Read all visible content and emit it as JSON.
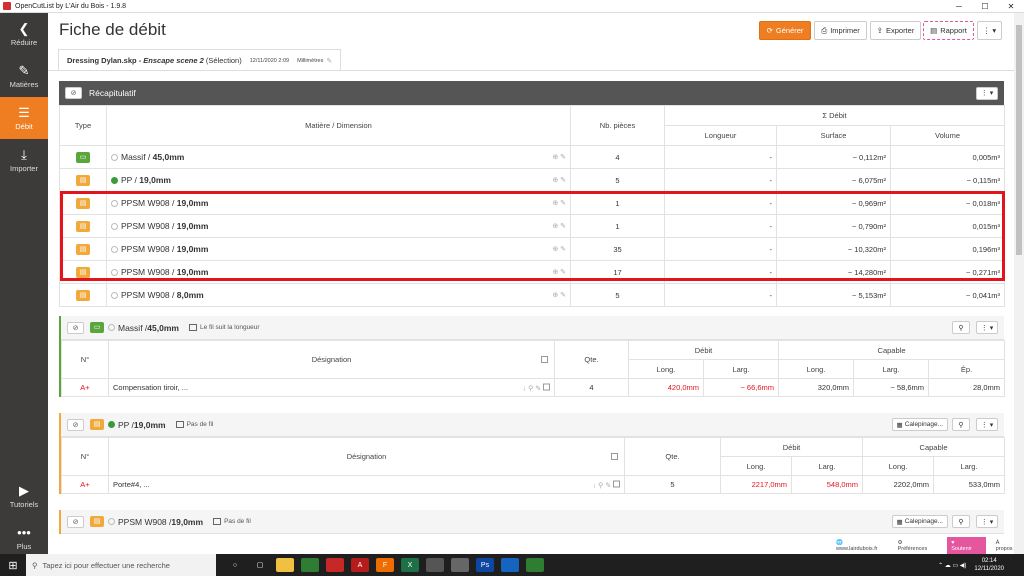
{
  "window": {
    "title": "OpenCutList by L'Air du Bois - 1.9.8"
  },
  "sidebar": {
    "items": [
      {
        "label": "Réduire",
        "icon": "chevron-left-icon"
      },
      {
        "label": "Matières",
        "icon": "materials-icon"
      },
      {
        "label": "Débit",
        "icon": "cutlist-icon"
      },
      {
        "label": "Importer",
        "icon": "import-icon"
      }
    ],
    "bottom": [
      {
        "label": "Tutoriels",
        "icon": "play-icon"
      },
      {
        "label": "Plus",
        "icon": "more-icon"
      }
    ]
  },
  "header": {
    "title": "Fiche de débit",
    "buttons": {
      "generate": "Générer",
      "print": "Imprimer",
      "export": "Exporter",
      "report": "Rapport"
    }
  },
  "doc_tab": {
    "filename": "Dressing Dylan.skp -",
    "scene": "Enscape scene 2",
    "selection": "(Sélection)",
    "date": "12/11/2020 2:09",
    "unit": "Millimètres"
  },
  "summary": {
    "title": "Récapitulatif",
    "headers": {
      "type": "Type",
      "material": "Matière / Dimension",
      "count": "Nb. pièces",
      "sum": "Σ Débit",
      "length": "Longueur",
      "surface": "Surface",
      "volume": "Volume"
    },
    "rows": [
      {
        "type": "green",
        "mat_name": "Massif / ",
        "mat_dim": "45,0mm",
        "count": "4",
        "length": "-",
        "surface": "~ 0,112m²",
        "volume": "0,005m³"
      },
      {
        "type": "orange",
        "mat_name": "PP / ",
        "mat_dim": "19,0mm",
        "count": "5",
        "length": "-",
        "surface": "~ 6,075m²",
        "volume": "~ 0,115m³"
      },
      {
        "type": "orange",
        "mat_name": "PPSM W908 / ",
        "mat_dim": "19,0mm",
        "count": "1",
        "length": "-",
        "surface": "~ 0,969m²",
        "volume": "~ 0,018m³"
      },
      {
        "type": "orange",
        "mat_name": "PPSM W908 / ",
        "mat_dim": "19,0mm",
        "count": "1",
        "length": "-",
        "surface": "~ 0,790m²",
        "volume": "0,015m³"
      },
      {
        "type": "orange",
        "mat_name": "PPSM W908 / ",
        "mat_dim": "19,0mm",
        "count": "35",
        "length": "-",
        "surface": "~ 10,320m²",
        "volume": "0,196m³"
      },
      {
        "type": "orange",
        "mat_name": "PPSM W908 / ",
        "mat_dim": "19,0mm",
        "count": "17",
        "length": "-",
        "surface": "~ 14,280m²",
        "volume": "~ 0,271m³"
      },
      {
        "type": "orange",
        "mat_name": "PPSM W908 / ",
        "mat_dim": "8,0mm",
        "count": "5",
        "length": "-",
        "surface": "~ 5,153m²",
        "volume": "~ 0,041m³"
      }
    ]
  },
  "sections": [
    {
      "mat_name": "Massif / ",
      "mat_dim": "45,0mm",
      "grain": "Le fil suit la longueur",
      "headers": {
        "num": "N°",
        "designation": "Désignation",
        "qty": "Qte.",
        "debit": "Débit",
        "capable": "Capable",
        "long": "Long.",
        "larg": "Larg.",
        "ep": "Ép."
      },
      "row": {
        "num": "A+",
        "designation": "Compensation tiroir, ...",
        "qty": "4",
        "d_long": "420,0mm",
        "d_larg": "~ 66,6mm",
        "c_long": "320,0mm",
        "c_larg": "~ 58,6mm",
        "c_ep": "28,0mm"
      }
    },
    {
      "mat_name": "PP / ",
      "mat_dim": "19,0mm",
      "grain": "Pas de fil",
      "calepinage": "Calepinage...",
      "headers": {
        "num": "N°",
        "designation": "Désignation",
        "qty": "Qte.",
        "debit": "Débit",
        "capable": "Capable",
        "long": "Long.",
        "larg": "Larg."
      },
      "row": {
        "num": "A+",
        "designation": "Porte#4, ...",
        "qty": "5",
        "d_long": "2217,0mm",
        "d_larg": "548,0mm",
        "c_long": "2202,0mm",
        "c_larg": "533,0mm"
      }
    },
    {
      "mat_name": "PPSM W908 / ",
      "mat_dim": "19,0mm",
      "grain": "Pas de fil",
      "calepinage": "Calepinage..."
    }
  ],
  "statusbar": {
    "site": "www.lairdubois.fr",
    "prefs": "Préférences",
    "support": "Soutenir",
    "about": "À propos"
  },
  "taskbar": {
    "search_placeholder": "Tapez ici pour effectuer une recherche",
    "time": "02:14",
    "date": "12/11/2020"
  }
}
